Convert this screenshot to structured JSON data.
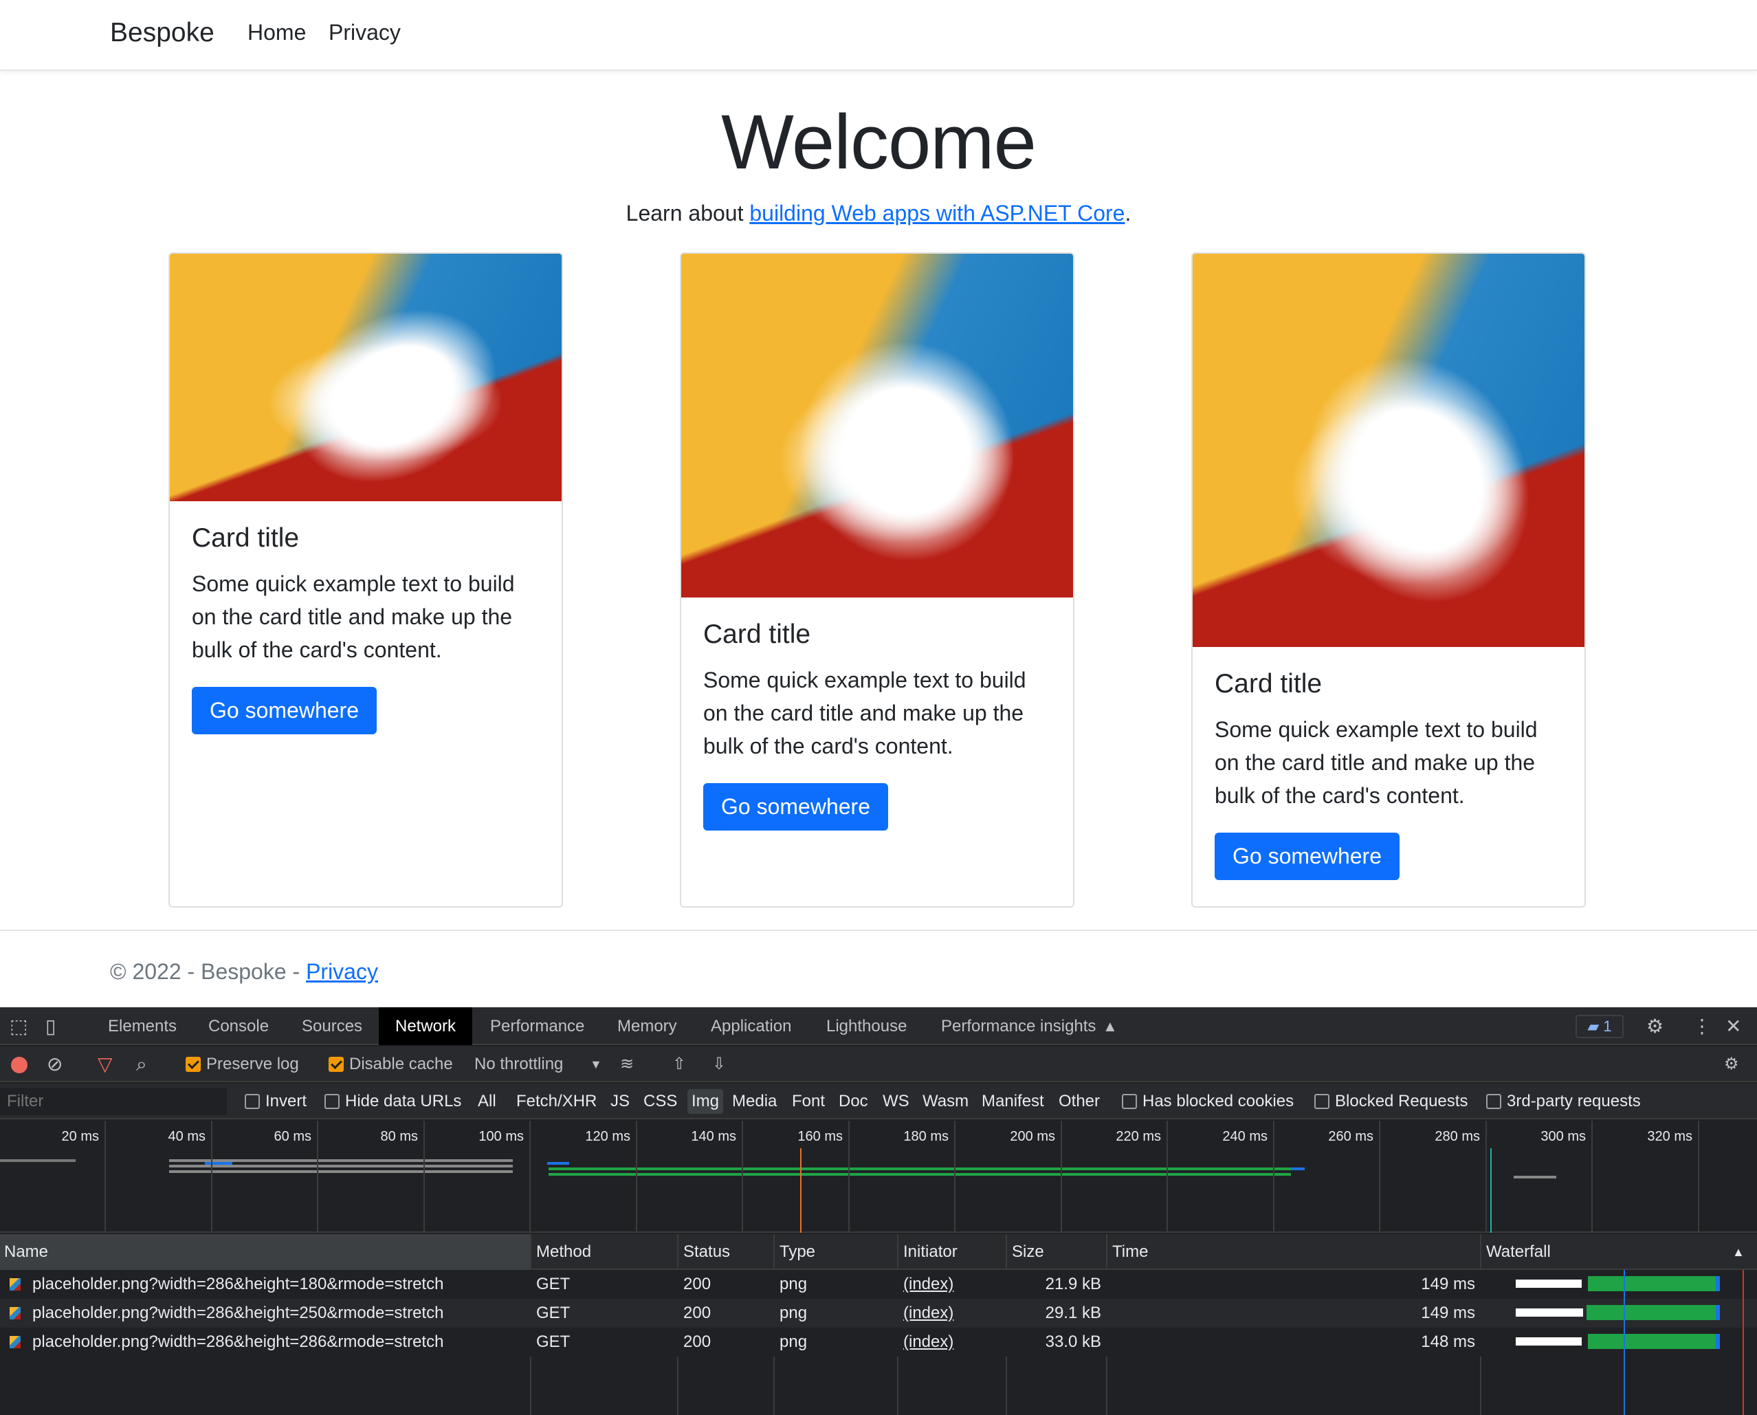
{
  "site": {
    "brand": "Bespoke",
    "nav": [
      "Home",
      "Privacy"
    ],
    "heading": "Welcome",
    "learn_prefix": "Learn about ",
    "learn_link": "building Web apps with ASP.NET Core",
    "learn_suffix": ".",
    "cards": [
      {
        "title": "Card title",
        "text": "Some quick example text to build on the card title and make up the bulk of the card's content.",
        "button": "Go somewhere"
      },
      {
        "title": "Card title",
        "text": "Some quick example text to build on the card title and make up the bulk of the card's content.",
        "button": "Go somewhere"
      },
      {
        "title": "Card title",
        "text": "Some quick example text to build on the card title and make up the bulk of the card's content.",
        "button": "Go somewhere"
      }
    ],
    "footer_text": "© 2022 - Bespoke - ",
    "footer_link": "Privacy"
  },
  "devtools": {
    "tabs": [
      "Elements",
      "Console",
      "Sources",
      "Network",
      "Performance",
      "Memory",
      "Application",
      "Lighthouse",
      "Performance insights"
    ],
    "active_tab": "Network",
    "issues_count": "1",
    "toolbar": {
      "preserve_log": "Preserve log",
      "disable_cache": "Disable cache",
      "throttling": "No throttling"
    },
    "filter": {
      "placeholder": "Filter",
      "invert": "Invert",
      "hide_data_urls": "Hide data URLs",
      "types": [
        "All",
        "Fetch/XHR",
        "JS",
        "CSS",
        "Img",
        "Media",
        "Font",
        "Doc",
        "WS",
        "Wasm",
        "Manifest",
        "Other"
      ],
      "selected_type": "Img",
      "has_blocked_cookies": "Has blocked cookies",
      "blocked_requests": "Blocked Requests",
      "third_party": "3rd-party requests"
    },
    "timeline_ticks": [
      "20 ms",
      "40 ms",
      "60 ms",
      "80 ms",
      "100 ms",
      "120 ms",
      "140 ms",
      "160 ms",
      "180 ms",
      "200 ms",
      "220 ms",
      "240 ms",
      "260 ms",
      "280 ms",
      "300 ms",
      "320 ms"
    ],
    "columns": [
      "Name",
      "Method",
      "Status",
      "Type",
      "Initiator",
      "Size",
      "Time",
      "Waterfall"
    ],
    "requests": [
      {
        "name": "placeholder.png?width=286&height=180&rmode=stretch",
        "method": "GET",
        "status": "200",
        "type": "png",
        "initiator": "(index)",
        "size": "21.9 kB",
        "time": "149 ms"
      },
      {
        "name": "placeholder.png?width=286&height=250&rmode=stretch",
        "method": "GET",
        "status": "200",
        "type": "png",
        "initiator": "(index)",
        "size": "29.1 kB",
        "time": "149 ms"
      },
      {
        "name": "placeholder.png?width=286&height=286&rmode=stretch",
        "method": "GET",
        "status": "200",
        "type": "png",
        "initiator": "(index)",
        "size": "33.0 kB",
        "time": "148 ms"
      }
    ],
    "colors": {
      "accent": "#0d6efd",
      "record": "#ee675c",
      "checkbox": "#f29900",
      "waterfall_green": "#1ea446",
      "waterfall_blue": "#1a73e8"
    }
  }
}
